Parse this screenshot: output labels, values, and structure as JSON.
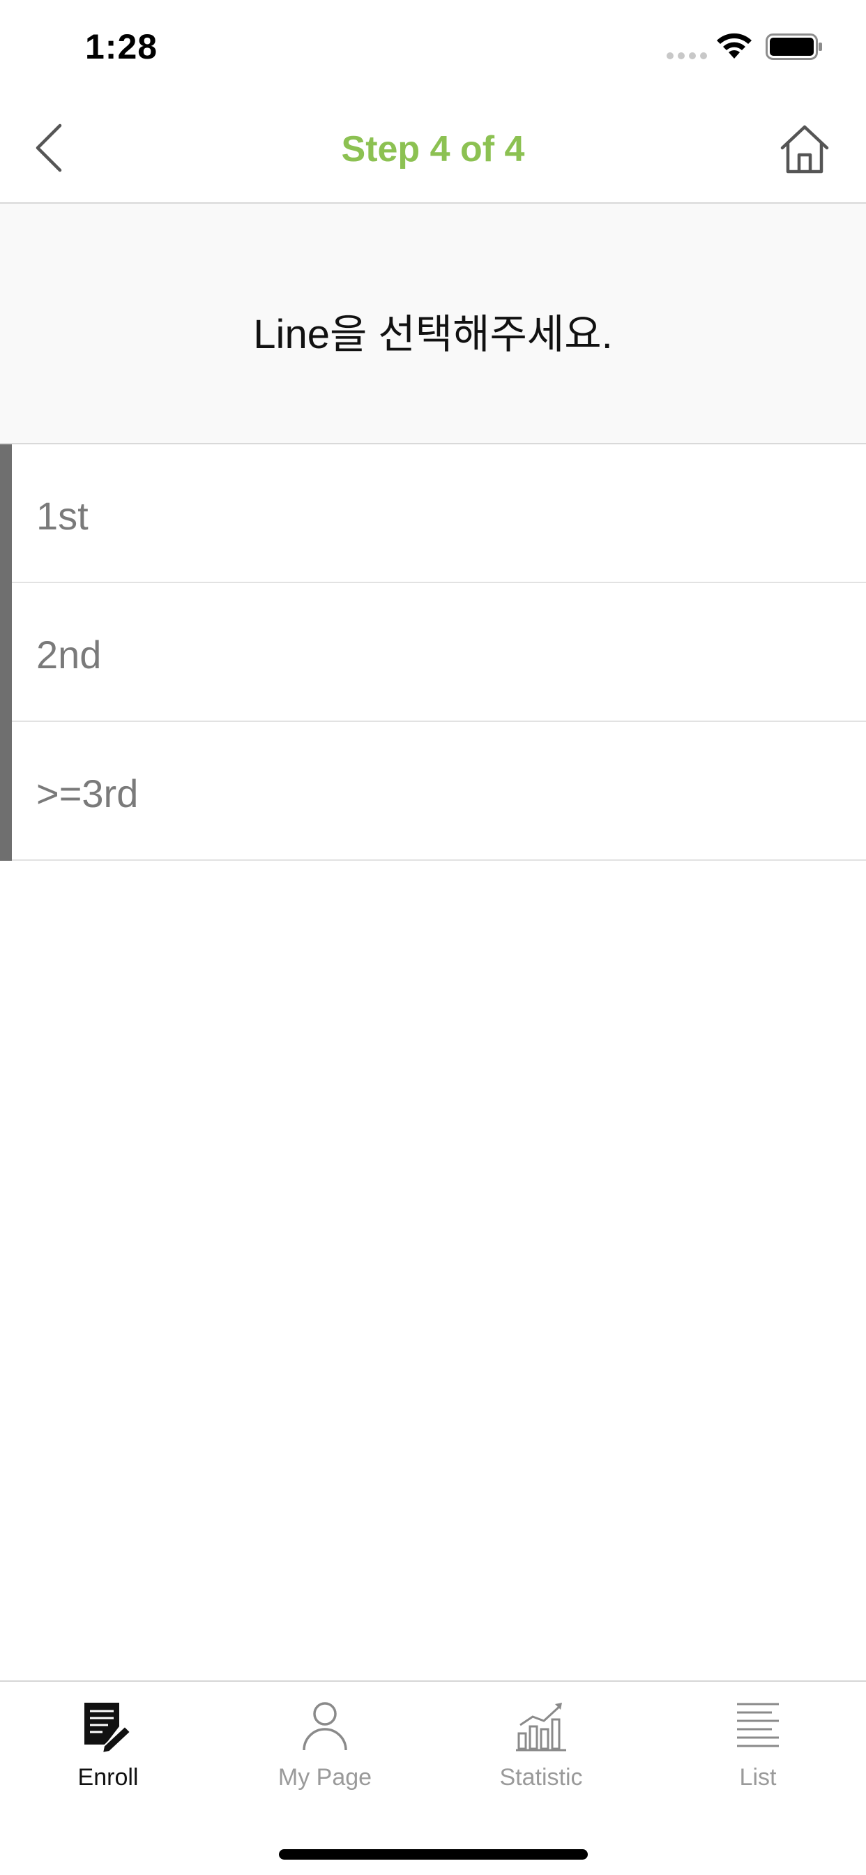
{
  "status_bar": {
    "time": "1:28",
    "signal_icon": "cellular-dots-icon",
    "wifi_icon": "wifi-icon",
    "battery_icon": "battery-full-icon"
  },
  "nav": {
    "back_icon": "chevron-left-icon",
    "title": "Step 4 of 4",
    "home_icon": "home-icon",
    "title_color": "#8cc152"
  },
  "prompt": {
    "text": "Line을 선택해주세요."
  },
  "options": [
    {
      "label": "1st"
    },
    {
      "label": "2nd"
    },
    {
      "label": ">=3rd"
    }
  ],
  "tabs": [
    {
      "label": "Enroll",
      "icon": "enroll-document-pencil-icon",
      "active": true
    },
    {
      "label": "My Page",
      "icon": "person-icon",
      "active": false
    },
    {
      "label": "Statistic",
      "icon": "bar-chart-icon",
      "active": false
    },
    {
      "label": "List",
      "icon": "list-lines-icon",
      "active": false
    }
  ]
}
